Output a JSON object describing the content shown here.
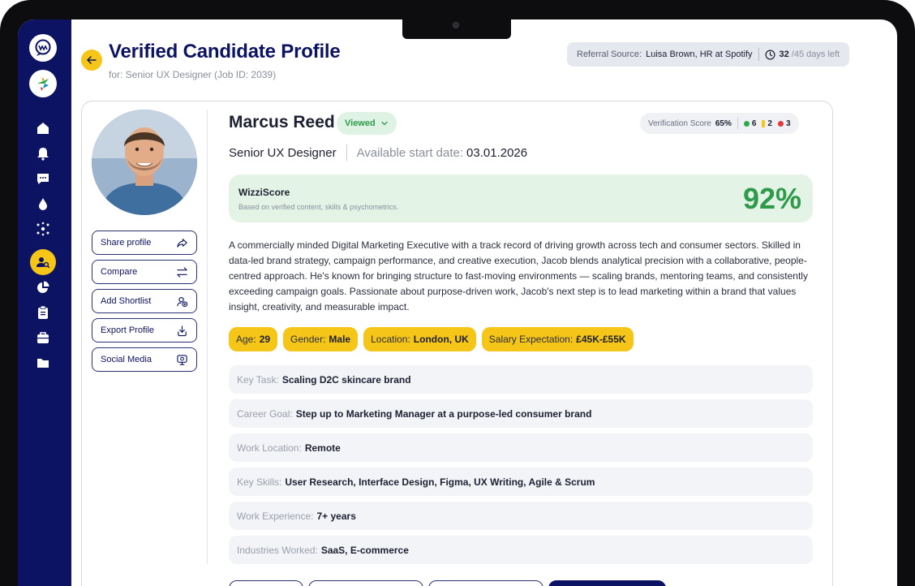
{
  "header": {
    "title": "Verified Candidate Profile",
    "subtitle": "for: Senior UX Designer (Job ID: 2039)",
    "referral_label": "Referral Source:",
    "referral_value": "Luisa Brown, HR at Spotify",
    "days_count": "32",
    "days_left": "/45 days left"
  },
  "sidebar": {
    "icons": [
      "home-icon",
      "bell-icon",
      "chat-icon",
      "drop-icon",
      "network-icon",
      "candidate-search-icon",
      "pie-chart-icon",
      "clipboard-icon",
      "briefcase-icon",
      "folder-icon"
    ],
    "active": "candidate-search-icon"
  },
  "actions": {
    "share": "Share profile",
    "compare": "Compare",
    "shortlist": "Add Shortlist",
    "export": "Export Profile",
    "social": "Social Media"
  },
  "candidate": {
    "name": "Marcus Reed",
    "status": "Viewed",
    "role": "Senior UX Designer",
    "start_label": "Available start date:",
    "start_date": "03.01.2026",
    "verification_label": "Verification Score",
    "verification_score": "65%",
    "verified_count": "6",
    "warning_count": "2",
    "failed_count": "3"
  },
  "wizzi": {
    "title": "WizziScore",
    "subtitle": "Based on verified content, skills & psychometrics.",
    "score": "92%"
  },
  "bio": "A commercially minded Digital Marketing Executive with a track record of driving growth across tech and consumer sectors. Skilled in data-led brand strategy, campaign performance, and creative execution, Jacob blends analytical precision with a collaborative, people-centred approach. He's known for bringing structure to fast-moving environments — scaling brands, mentoring teams, and consistently exceeding campaign goals. Passionate about purpose-driven work, Jacob's next step is to lead marketing within a brand that values insight, creativity, and measurable impact.",
  "chips": {
    "age_label": "Age:",
    "age": "29",
    "gender_label": "Gender:",
    "gender": "Male",
    "location_label": "Location:",
    "location": "London, UK",
    "salary_label": "Salary Expectation:",
    "salary": "£45K-£55K"
  },
  "details": {
    "key_task_label": "Key Task:",
    "key_task": "Scaling D2C skincare brand",
    "career_goal_label": "Career Goal:",
    "career_goal": "Step up to Marketing Manager at a purpose-led consumer brand",
    "work_location_label": "Work Location:",
    "work_location": "Remote",
    "key_skills_label": "Key Skills:",
    "key_skills": "User Research, Interface Design, Figma, UX Writing, Agile & Scrum",
    "experience_label": "Work Experience:",
    "experience": "7+ years",
    "industries_label": "Industries Worked:",
    "industries": "SaaS, E-commerce"
  },
  "colors": {
    "navy": "#0d1363",
    "yellow": "#f5c518",
    "green": "#2e9a4a",
    "green_bg": "#e3f4e7"
  }
}
